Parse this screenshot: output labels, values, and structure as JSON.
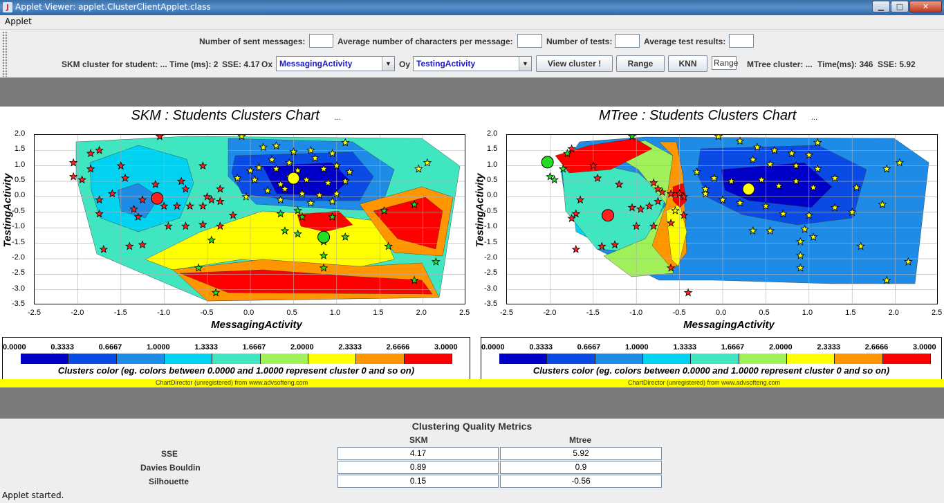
{
  "window": {
    "title": "Applet Viewer: applet.ClusterClientApplet.class",
    "min": "▁",
    "max": "□",
    "close": "✕"
  },
  "menu": {
    "applet": "Applet"
  },
  "controls": {
    "sent_label": "Number of sent messages:",
    "avg_chars_label": "Average number of characters per message:",
    "num_tests_label": "Number of tests:",
    "avg_test_label": "Average test results:",
    "skm_label": "SKM cluster for student: ...",
    "skm_time": "Time (ms): 2",
    "skm_sse": "SSE: 4.17",
    "ox_label": "Ox",
    "ox_value": "MessagingActivity",
    "oy_label": "Oy",
    "oy_value": "TestingActivity",
    "view_button": "View cluster !",
    "range_button": "Range",
    "knn_button": "KNN",
    "range_field": "Range",
    "mtree_label": "MTree cluster: ...",
    "mtree_time": "Time(ms): 346",
    "mtree_sse": "SSE: 5.92"
  },
  "charts": [
    {
      "title": "SKM : Students Clusters Chart",
      "title_note": "...",
      "xlabel": "MessagingActivity",
      "ylabel": "TestingActivity"
    },
    {
      "title": "MTree : Students Clusters Chart",
      "title_note": "...",
      "xlabel": "MessagingActivity",
      "ylabel": "TestingActivity"
    }
  ],
  "axes": {
    "x_ticks": [
      "-2.5",
      "-2.0",
      "-1.5",
      "-1.0",
      "-0.5",
      "0.0",
      "0.5",
      "1.0",
      "1.5",
      "2.0",
      "2.5"
    ],
    "y_ticks": [
      "2.0",
      "1.5",
      "1.0",
      "0.5",
      "0.0",
      "-0.5",
      "-1.0",
      "-1.5",
      "-2.0",
      "-2.5",
      "-3.0",
      "-3.5"
    ]
  },
  "legend": {
    "ticks": [
      "0.0000",
      "0.3333",
      "0.6667",
      "1.0000",
      "1.3333",
      "1.6667",
      "2.0000",
      "2.3333",
      "2.6666",
      "3.0000"
    ],
    "colors": [
      "#0000c8",
      "#0a4be6",
      "#1e8ce6",
      "#00d2f0",
      "#40e6c0",
      "#a0f05a",
      "#ffff00",
      "#ff9600",
      "#ff0000"
    ],
    "caption": "Clusters color (eg. colors between 0.0000 and 1.0000 represent cluster 0 and so on)"
  },
  "credit": "ChartDirector (unregistered) from www.advsofteng.com",
  "chart_data": [
    {
      "type": "scatter",
      "title": "SKM : Students Clusters Chart",
      "xlabel": "MessagingActivity",
      "ylabel": "TestingActivity",
      "xlim": [
        -2.5,
        2.5
      ],
      "ylim": [
        -3.5,
        2.0
      ],
      "grid": true,
      "centroids": [
        {
          "cluster": 0,
          "x": 0.5,
          "y": 0.6,
          "color": "#ffff00"
        },
        {
          "cluster": 1,
          "x": 0.85,
          "y": -1.3,
          "color": "#22dd22"
        },
        {
          "cluster": 2,
          "x": -1.08,
          "y": -0.05,
          "color": "#ff2020"
        }
      ],
      "series": [
        {
          "name": "cluster 0",
          "color": "#ffff00",
          "points": [
            [
              -0.1,
              1.95
            ],
            [
              0.15,
              1.6
            ],
            [
              0.3,
              1.65
            ],
            [
              0.5,
              1.45
            ],
            [
              0.7,
              1.5
            ],
            [
              0.95,
              1.4
            ],
            [
              1.1,
              1.75
            ],
            [
              0.25,
              1.2
            ],
            [
              0.45,
              1.1
            ],
            [
              0.75,
              1.25
            ],
            [
              0.1,
              0.95
            ],
            [
              0.3,
              0.9
            ],
            [
              0.55,
              0.85
            ],
            [
              0.85,
              0.9
            ],
            [
              1.0,
              1.0
            ],
            [
              1.15,
              0.8
            ],
            [
              -0.15,
              0.6
            ],
            [
              0.05,
              0.55
            ],
            [
              0.35,
              0.4
            ],
            [
              0.65,
              0.55
            ],
            [
              0.9,
              0.45
            ],
            [
              1.1,
              0.5
            ],
            [
              0.2,
              0.2
            ],
            [
              0.4,
              0.25
            ],
            [
              0.6,
              0.1
            ],
            [
              0.8,
              0.05
            ],
            [
              1.0,
              0.1
            ],
            [
              -0.05,
              0.0
            ],
            [
              0.35,
              -0.1
            ],
            [
              0.7,
              -0.2
            ],
            [
              0.95,
              -0.15
            ],
            [
              1.95,
              0.9
            ],
            [
              2.05,
              1.1
            ],
            [
              0.45,
              0.65
            ],
            [
              0.0,
              0.85
            ]
          ]
        },
        {
          "name": "cluster 1",
          "color": "#22dd22",
          "points": [
            [
              0.35,
              -0.55
            ],
            [
              0.55,
              -0.45
            ],
            [
              0.95,
              -0.65
            ],
            [
              1.55,
              -0.45
            ],
            [
              1.9,
              -0.25
            ],
            [
              0.4,
              -1.1
            ],
            [
              0.55,
              -1.2
            ],
            [
              1.1,
              -1.3
            ],
            [
              0.85,
              -1.45
            ],
            [
              1.6,
              -1.6
            ],
            [
              0.85,
              -1.9
            ],
            [
              0.85,
              -2.3
            ],
            [
              2.15,
              -2.1
            ],
            [
              1.9,
              -2.7
            ],
            [
              -0.6,
              -2.3
            ],
            [
              -0.4,
              -3.1
            ],
            [
              -0.45,
              -1.4
            ],
            [
              0.6,
              -0.65
            ]
          ]
        },
        {
          "name": "cluster 2",
          "color": "#ff2020",
          "points": [
            [
              -2.05,
              1.1
            ],
            [
              -1.85,
              1.4
            ],
            [
              -1.75,
              1.5
            ],
            [
              -2.05,
              0.65
            ],
            [
              -1.95,
              0.55
            ],
            [
              -1.85,
              0.9
            ],
            [
              -1.5,
              1.0
            ],
            [
              -1.45,
              0.6
            ],
            [
              -1.6,
              0.1
            ],
            [
              -1.75,
              -0.1
            ],
            [
              -1.75,
              -0.55
            ],
            [
              -1.35,
              -0.4
            ],
            [
              -1.3,
              -0.65
            ],
            [
              -1.25,
              -0.1
            ],
            [
              -1.1,
              0.4
            ],
            [
              -1.0,
              -0.3
            ],
            [
              -0.85,
              -0.3
            ],
            [
              -0.8,
              0.5
            ],
            [
              -0.75,
              0.25
            ],
            [
              -0.7,
              -0.3
            ],
            [
              -0.55,
              -0.3
            ],
            [
              -0.5,
              0.0
            ],
            [
              -0.45,
              -0.1
            ],
            [
              -0.35,
              -0.15
            ],
            [
              -0.95,
              -0.95
            ],
            [
              -0.75,
              -0.95
            ],
            [
              -0.55,
              -0.9
            ],
            [
              -0.35,
              -0.95
            ],
            [
              -1.25,
              -1.55
            ],
            [
              -1.4,
              -1.6
            ],
            [
              -1.7,
              -1.7
            ],
            [
              -0.55,
              1.0
            ],
            [
              -1.05,
              1.95
            ],
            [
              -0.2,
              -0.6
            ],
            [
              -0.35,
              0.25
            ]
          ]
        }
      ]
    },
    {
      "type": "scatter",
      "title": "MTree : Students Clusters Chart",
      "xlabel": "MessagingActivity",
      "ylabel": "TestingActivity",
      "xlim": [
        -2.5,
        2.5
      ],
      "ylim": [
        -3.5,
        2.0
      ],
      "grid": true,
      "centroids": [
        {
          "cluster": 0,
          "x": 0.3,
          "y": 0.25,
          "color": "#ffff00"
        },
        {
          "cluster": 1,
          "x": -2.03,
          "y": 1.12,
          "color": "#22dd22"
        },
        {
          "cluster": 2,
          "x": -1.33,
          "y": -0.6,
          "color": "#ff2020"
        }
      ],
      "series": [
        {
          "name": "cluster 0",
          "color": "#ffff00",
          "points": [
            [
              -0.05,
              1.95
            ],
            [
              0.2,
              1.8
            ],
            [
              0.4,
              1.6
            ],
            [
              0.6,
              1.5
            ],
            [
              0.8,
              1.4
            ],
            [
              1.0,
              1.35
            ],
            [
              1.1,
              1.75
            ],
            [
              0.35,
              1.2
            ],
            [
              0.55,
              1.05
            ],
            [
              0.85,
              1.0
            ],
            [
              1.1,
              0.9
            ],
            [
              -0.3,
              0.8
            ],
            [
              -0.1,
              0.6
            ],
            [
              0.1,
              0.5
            ],
            [
              0.45,
              0.55
            ],
            [
              0.65,
              0.35
            ],
            [
              0.85,
              0.5
            ],
            [
              1.05,
              0.3
            ],
            [
              1.3,
              0.6
            ],
            [
              1.55,
              0.3
            ],
            [
              -0.2,
              0.1
            ],
            [
              0.0,
              -0.1
            ],
            [
              0.2,
              -0.2
            ],
            [
              0.5,
              -0.3
            ],
            [
              0.7,
              -0.55
            ],
            [
              1.0,
              -0.6
            ],
            [
              1.3,
              -0.35
            ],
            [
              1.5,
              -0.5
            ],
            [
              1.9,
              0.9
            ],
            [
              2.05,
              1.1
            ],
            [
              0.35,
              -1.1
            ],
            [
              0.55,
              -1.1
            ],
            [
              0.95,
              -1.05
            ],
            [
              1.05,
              -1.3
            ],
            [
              0.9,
              -1.45
            ],
            [
              0.9,
              -1.9
            ],
            [
              0.9,
              -2.3
            ],
            [
              1.6,
              -1.6
            ],
            [
              1.85,
              -0.25
            ],
            [
              2.15,
              -2.1
            ],
            [
              1.9,
              -2.7
            ],
            [
              -0.55,
              -0.45
            ],
            [
              -0.5,
              0.1
            ],
            [
              -0.2,
              0.25
            ]
          ]
        },
        {
          "name": "cluster 1",
          "color": "#22dd22",
          "points": [
            [
              -2.0,
              0.65
            ],
            [
              -1.95,
              0.55
            ],
            [
              -1.85,
              0.9
            ],
            [
              -1.8,
              1.4
            ],
            [
              -1.05,
              1.95
            ],
            [
              -2.03,
              1.12
            ]
          ]
        },
        {
          "name": "cluster 2",
          "color": "#ff2020",
          "points": [
            [
              -1.75,
              1.55
            ],
            [
              -1.5,
              1.0
            ],
            [
              -1.45,
              0.6
            ],
            [
              -1.2,
              0.4
            ],
            [
              -0.8,
              0.45
            ],
            [
              -0.75,
              0.25
            ],
            [
              -0.7,
              0.15
            ],
            [
              -0.6,
              0.1
            ],
            [
              -0.5,
              0.1
            ],
            [
              -0.45,
              0.0
            ],
            [
              -0.75,
              -0.15
            ],
            [
              -0.85,
              -0.3
            ],
            [
              -0.95,
              -0.4
            ],
            [
              -1.05,
              -0.35
            ],
            [
              -1.35,
              -0.6
            ],
            [
              -1.65,
              -0.1
            ],
            [
              -1.7,
              -0.55
            ],
            [
              -1.75,
              -0.7
            ],
            [
              -1.0,
              -0.95
            ],
            [
              -0.8,
              -0.95
            ],
            [
              -0.6,
              -0.85
            ],
            [
              -0.45,
              -0.6
            ],
            [
              -1.4,
              -1.6
            ],
            [
              -1.25,
              -1.55
            ],
            [
              -1.7,
              -1.7
            ],
            [
              -0.6,
              -2.3
            ],
            [
              -0.4,
              -3.1
            ]
          ]
        }
      ]
    }
  ],
  "metrics": {
    "title": "Clustering Quality Metrics",
    "columns": [
      "SKM",
      "Mtree"
    ],
    "rows": [
      {
        "label": "SSE",
        "skm": "4.17",
        "mtree": "5.92"
      },
      {
        "label": "Davies Bouldin",
        "skm": "0.89",
        "mtree": "0.9"
      },
      {
        "label": "Silhouette",
        "skm": "0.15",
        "mtree": "-0.56"
      }
    ]
  },
  "status": {
    "text": "Applet started."
  }
}
